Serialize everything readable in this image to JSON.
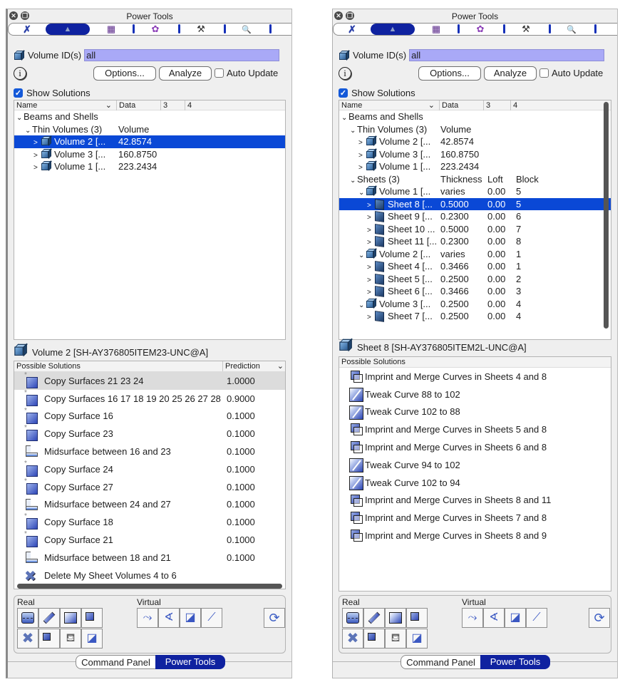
{
  "window": {
    "title": "Power Tools",
    "close_glyph": "✕",
    "restore_glyph": "❐"
  },
  "toolbar_tabs": [
    {
      "icon": "geometry-tools-icon",
      "glyph": "✗",
      "active": false
    },
    {
      "icon": "mesh-tools-icon",
      "glyph": "▲",
      "active": true
    },
    {
      "icon": "meshing-scheme-icon",
      "glyph": "▦",
      "active": false
    },
    {
      "icon": "quality-badge-icon",
      "glyph": "✿",
      "active": false
    },
    {
      "icon": "tweak-hammer-icon",
      "glyph": "⚒",
      "active": false
    },
    {
      "icon": "search-icon",
      "glyph": "🔍",
      "active": false
    }
  ],
  "colors": {
    "accent": "#0f22a0",
    "selection": "#0a48d6",
    "input_bg": "#a9a9f7",
    "checkbox": "#1459d9"
  },
  "volume_ids": {
    "label": "Volume ID(s)",
    "value": "all"
  },
  "actions": {
    "info_glyph": "i",
    "options_label": "Options...",
    "analyze_label": "Analyze",
    "auto_update_label": "Auto Update",
    "auto_update_checked": false
  },
  "show_solutions": {
    "label": "Show Solutions",
    "checked": true,
    "check_glyph": "✓"
  },
  "tree_headers": [
    "Name",
    "Data",
    "3",
    "4"
  ],
  "tree_sort_glyph": "⌄",
  "left": {
    "tree_rows": [
      {
        "indent": 0,
        "arrow": "⌄",
        "icon": "",
        "name": "Beams and Shells",
        "data": "",
        "c3": "",
        "c4": "",
        "selected": false
      },
      {
        "indent": 1,
        "arrow": "⌄",
        "icon": "",
        "name": "Thin Volumes (3)",
        "data": "Volume",
        "c3": "",
        "c4": "",
        "selected": false
      },
      {
        "indent": 2,
        "arrow": ">",
        "icon": "cube",
        "name": "Volume 2 [...",
        "data": "42.8574",
        "c3": "",
        "c4": "",
        "selected": true
      },
      {
        "indent": 2,
        "arrow": ">",
        "icon": "cube",
        "name": "Volume 3 [...",
        "data": "160.8750",
        "c3": "",
        "c4": "",
        "selected": false
      },
      {
        "indent": 2,
        "arrow": ">",
        "icon": "cube",
        "name": "Volume 1 [...",
        "data": "223.2434",
        "c3": "",
        "c4": "",
        "selected": false
      }
    ],
    "selection_header": "Volume 2 [SH-AY376805ITEM23-UNC@A]",
    "solutions_header": "Possible Solutions",
    "prediction_header": "Prediction",
    "solutions": [
      {
        "icon": "copy-surface",
        "text": "Copy Surfaces 21 23 24",
        "value": "1.0000",
        "highlight": true
      },
      {
        "icon": "copy-surface",
        "text": "Copy Surfaces 16 17 18 19 20 25 26 27 28",
        "value": "0.9000",
        "highlight": false
      },
      {
        "icon": "copy-surface",
        "text": "Copy Surface 16",
        "value": "0.1000",
        "highlight": false
      },
      {
        "icon": "copy-surface",
        "text": "Copy Surface 23",
        "value": "0.1000",
        "highlight": false
      },
      {
        "icon": "midsurface",
        "text": "Midsurface between 16 and 23",
        "value": "0.1000",
        "highlight": false
      },
      {
        "icon": "copy-surface",
        "text": "Copy Surface 24",
        "value": "0.1000",
        "highlight": false
      },
      {
        "icon": "copy-surface",
        "text": "Copy Surface 27",
        "value": "0.1000",
        "highlight": false
      },
      {
        "icon": "midsurface",
        "text": "Midsurface between 24 and 27",
        "value": "0.1000",
        "highlight": false
      },
      {
        "icon": "copy-surface",
        "text": "Copy Surface 18",
        "value": "0.1000",
        "highlight": false
      },
      {
        "icon": "copy-surface",
        "text": "Copy Surface 21",
        "value": "0.1000",
        "highlight": false
      },
      {
        "icon": "midsurface",
        "text": "Midsurface between 18 and 21",
        "value": "0.1000",
        "highlight": false
      },
      {
        "icon": "delete",
        "text": "Delete My Sheet Volumes 4 to 6",
        "value": "",
        "highlight": false
      }
    ]
  },
  "right": {
    "tree_rows": [
      {
        "indent": 0,
        "arrow": "⌄",
        "icon": "",
        "name": "Beams and Shells",
        "data": "",
        "c3": "",
        "c4": "",
        "selected": false
      },
      {
        "indent": 1,
        "arrow": "⌄",
        "icon": "",
        "name": "Thin Volumes (3)",
        "data": "Volume",
        "c3": "",
        "c4": "",
        "selected": false
      },
      {
        "indent": 2,
        "arrow": ">",
        "icon": "cube",
        "name": "Volume 2 [...",
        "data": "42.8574",
        "c3": "",
        "c4": "",
        "selected": false
      },
      {
        "indent": 2,
        "arrow": ">",
        "icon": "cube",
        "name": "Volume 3 [...",
        "data": "160.8750",
        "c3": "",
        "c4": "",
        "selected": false
      },
      {
        "indent": 2,
        "arrow": ">",
        "icon": "cube",
        "name": "Volume 1 [...",
        "data": "223.2434",
        "c3": "",
        "c4": "",
        "selected": false
      },
      {
        "indent": 1,
        "arrow": "⌄",
        "icon": "",
        "name": "Sheets (3)",
        "data": "Thickness",
        "c3": "Loft",
        "c4": "Block",
        "selected": false
      },
      {
        "indent": 2,
        "arrow": "⌄",
        "icon": "cube",
        "name": "Volume 1 [...",
        "data": "varies",
        "c3": "0.00",
        "c4": "5",
        "selected": false
      },
      {
        "indent": 3,
        "arrow": ">",
        "icon": "sheet",
        "name": "Sheet 8 [...",
        "data": "0.5000",
        "c3": "0.00",
        "c4": "5",
        "selected": true
      },
      {
        "indent": 3,
        "arrow": ">",
        "icon": "sheet",
        "name": "Sheet 9 [...",
        "data": "0.2300",
        "c3": "0.00",
        "c4": "6",
        "selected": false
      },
      {
        "indent": 3,
        "arrow": ">",
        "icon": "sheet",
        "name": "Sheet 10 ...",
        "data": "0.5000",
        "c3": "0.00",
        "c4": "7",
        "selected": false
      },
      {
        "indent": 3,
        "arrow": ">",
        "icon": "sheet",
        "name": "Sheet 11 [...",
        "data": "0.2300",
        "c3": "0.00",
        "c4": "8",
        "selected": false
      },
      {
        "indent": 2,
        "arrow": "⌄",
        "icon": "cube",
        "name": "Volume 2 [...",
        "data": "varies",
        "c3": "0.00",
        "c4": "1",
        "selected": false
      },
      {
        "indent": 3,
        "arrow": ">",
        "icon": "sheet",
        "name": "Sheet 4 [...",
        "data": "0.3466",
        "c3": "0.00",
        "c4": "1",
        "selected": false
      },
      {
        "indent": 3,
        "arrow": ">",
        "icon": "sheet",
        "name": "Sheet 5 [...",
        "data": "0.2500",
        "c3": "0.00",
        "c4": "2",
        "selected": false
      },
      {
        "indent": 3,
        "arrow": ">",
        "icon": "sheet",
        "name": "Sheet 6 [...",
        "data": "0.3466",
        "c3": "0.00",
        "c4": "3",
        "selected": false
      },
      {
        "indent": 2,
        "arrow": "⌄",
        "icon": "cube",
        "name": "Volume 3 [...",
        "data": "0.2500",
        "c3": "0.00",
        "c4": "4",
        "selected": false
      },
      {
        "indent": 3,
        "arrow": ">",
        "icon": "sheet",
        "name": "Sheet 7 [...",
        "data": "0.2500",
        "c3": "0.00",
        "c4": "4",
        "selected": false
      }
    ],
    "selection_header": "Sheet 8 [SH-AY376805ITEM2L-UNC@A]",
    "solutions_header": "Possible Solutions",
    "solutions": [
      {
        "icon": "imprint-merge",
        "text": "Imprint and Merge Curves in Sheets 4 and 8"
      },
      {
        "icon": "tweak-curve",
        "text": "Tweak Curve 88 to 102"
      },
      {
        "icon": "tweak-curve",
        "text": "Tweak Curve 102 to 88"
      },
      {
        "icon": "imprint-merge",
        "text": "Imprint and Merge Curves in Sheets 5 and 8"
      },
      {
        "icon": "imprint-merge",
        "text": "Imprint and Merge Curves in Sheets 6 and 8"
      },
      {
        "icon": "tweak-curve",
        "text": "Tweak Curve 94 to 102"
      },
      {
        "icon": "tweak-curve",
        "text": "Tweak Curve 102 to 94"
      },
      {
        "icon": "imprint-merge",
        "text": "Imprint and Merge Curves in Sheets 8 and 11"
      },
      {
        "icon": "imprint-merge",
        "text": "Imprint and Merge Curves in Sheets 7 and 8"
      },
      {
        "icon": "imprint-merge",
        "text": "Imprint and Merge Curves in Sheets 8 and 9"
      }
    ]
  },
  "tool_groups": {
    "real_label": "Real",
    "virtual_label": "Virtual",
    "real_tools": [
      {
        "icon": "surface-face-icon",
        "glyph": ""
      },
      {
        "icon": "curve-line-icon",
        "glyph": ""
      },
      {
        "icon": "tweak-curve-icon",
        "glyph": ""
      },
      {
        "icon": "imprint-merge-icon",
        "glyph": ""
      },
      {
        "icon": "delete-x-icon",
        "glyph": "✖"
      },
      {
        "icon": "overlap-squares-icon",
        "glyph": ""
      },
      {
        "icon": "paint-bucket-icon",
        "glyph": "⛾"
      },
      {
        "icon": "collapse-corner-icon",
        "glyph": "◪"
      }
    ],
    "virtual_tools": [
      {
        "icon": "virtual-curve-merge-icon",
        "glyph": "⤳"
      },
      {
        "icon": "virtual-angle-icon",
        "glyph": "∢"
      },
      {
        "icon": "virtual-collapse-icon",
        "glyph": "◪"
      },
      {
        "icon": "virtual-split-icon",
        "glyph": "⟋"
      }
    ],
    "refresh_glyph": "⟳"
  },
  "bottom_tabs": {
    "command_panel": "Command Panel",
    "power_tools": "Power Tools"
  }
}
